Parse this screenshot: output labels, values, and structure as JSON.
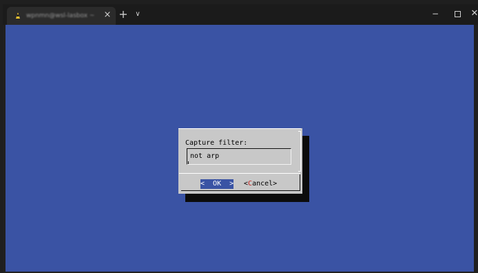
{
  "window": {
    "tab_title": "wpnmn@wsl-lasbox ~",
    "tab_close_glyph": "×",
    "new_tab_glyph": "+",
    "tab_dropdown_glyph": "∨",
    "min_glyph": "−",
    "close_glyph": "✕"
  },
  "dialog": {
    "label": "Capture filter:",
    "input_value": "not arp",
    "ok_label": "<  OK  >",
    "cancel_prefix": "<",
    "cancel_hotkey": "C",
    "cancel_rest": "ancel>"
  },
  "colors": {
    "terminal_bg": "#3a53a4",
    "dialog_bg": "#c8c8c8",
    "hotkey": "#c4231f"
  }
}
